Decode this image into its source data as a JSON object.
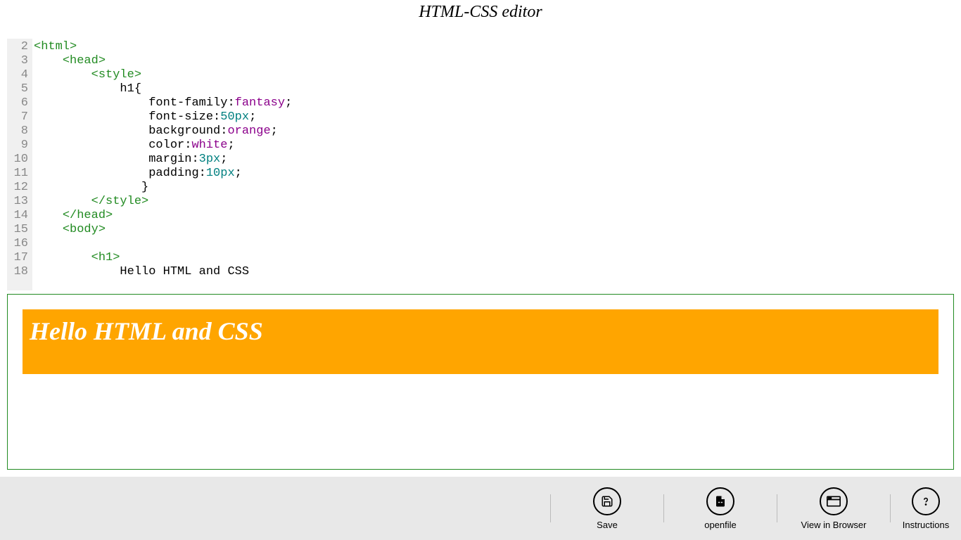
{
  "header": {
    "title": "HTML-CSS editor"
  },
  "editor": {
    "lines": [
      {
        "num": "2",
        "tokens": [
          {
            "cls": "tag",
            "t": "<html>"
          }
        ]
      },
      {
        "num": "3",
        "tokens": [
          {
            "cls": "",
            "t": "    "
          },
          {
            "cls": "tag",
            "t": "<head>"
          }
        ]
      },
      {
        "num": "4",
        "tokens": [
          {
            "cls": "",
            "t": "        "
          },
          {
            "cls": "tag",
            "t": "<style>"
          }
        ]
      },
      {
        "num": "5",
        "tokens": [
          {
            "cls": "",
            "t": "            "
          },
          {
            "cls": "prop",
            "t": "h1{"
          }
        ]
      },
      {
        "num": "6",
        "tokens": [
          {
            "cls": "",
            "t": "                "
          },
          {
            "cls": "prop",
            "t": "font-family:"
          },
          {
            "cls": "val",
            "t": "fantasy"
          },
          {
            "cls": "prop",
            "t": ";"
          }
        ]
      },
      {
        "num": "7",
        "tokens": [
          {
            "cls": "",
            "t": "                "
          },
          {
            "cls": "prop",
            "t": "font-size:"
          },
          {
            "cls": "num",
            "t": "50px"
          },
          {
            "cls": "prop",
            "t": ";"
          }
        ]
      },
      {
        "num": "8",
        "tokens": [
          {
            "cls": "",
            "t": "                "
          },
          {
            "cls": "prop",
            "t": "background:"
          },
          {
            "cls": "val",
            "t": "orange"
          },
          {
            "cls": "prop",
            "t": ";"
          }
        ]
      },
      {
        "num": "9",
        "tokens": [
          {
            "cls": "",
            "t": "                "
          },
          {
            "cls": "prop",
            "t": "color:"
          },
          {
            "cls": "val",
            "t": "white"
          },
          {
            "cls": "prop",
            "t": ";"
          }
        ]
      },
      {
        "num": "10",
        "tokens": [
          {
            "cls": "",
            "t": "                "
          },
          {
            "cls": "prop",
            "t": "margin:"
          },
          {
            "cls": "num",
            "t": "3px"
          },
          {
            "cls": "prop",
            "t": ";"
          }
        ]
      },
      {
        "num": "11",
        "tokens": [
          {
            "cls": "",
            "t": "                "
          },
          {
            "cls": "prop",
            "t": "padding:"
          },
          {
            "cls": "num",
            "t": "10px"
          },
          {
            "cls": "prop",
            "t": ";"
          }
        ]
      },
      {
        "num": "12",
        "tokens": [
          {
            "cls": "",
            "t": "               "
          },
          {
            "cls": "prop",
            "t": "}"
          }
        ]
      },
      {
        "num": "13",
        "tokens": [
          {
            "cls": "",
            "t": "        "
          },
          {
            "cls": "tag",
            "t": "</style>"
          }
        ]
      },
      {
        "num": "14",
        "tokens": [
          {
            "cls": "",
            "t": "    "
          },
          {
            "cls": "tag",
            "t": "</head>"
          }
        ]
      },
      {
        "num": "15",
        "tokens": [
          {
            "cls": "",
            "t": "    "
          },
          {
            "cls": "tag",
            "t": "<body>"
          }
        ]
      },
      {
        "num": "16",
        "tokens": []
      },
      {
        "num": "17",
        "tokens": [
          {
            "cls": "",
            "t": "        "
          },
          {
            "cls": "tag",
            "t": "<h1>"
          }
        ]
      },
      {
        "num": "18",
        "tokens": [
          {
            "cls": "",
            "t": "            "
          },
          {
            "cls": "text",
            "t": "Hello HTML and CSS"
          }
        ]
      }
    ]
  },
  "preview": {
    "heading_text": "Hello HTML and CSS"
  },
  "toolbar": {
    "save_label": "Save",
    "openfile_label": "openfile",
    "view_label": "View in Browser",
    "instructions_label": "Instructions"
  }
}
